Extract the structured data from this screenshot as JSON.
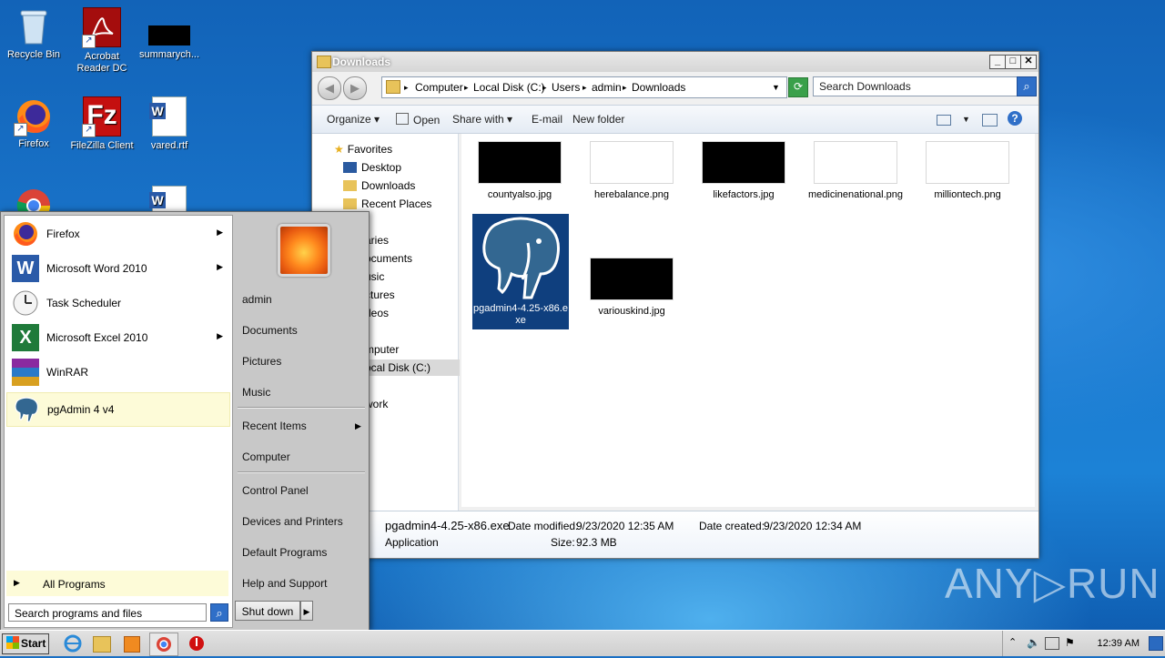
{
  "desktop": {
    "icons": [
      {
        "label": "Recycle Bin"
      },
      {
        "label": "Acrobat Reader DC"
      },
      {
        "label": "summarych..."
      },
      {
        "label": "Firefox"
      },
      {
        "label": "FileZilla Client"
      },
      {
        "label": "vared.rtf"
      }
    ]
  },
  "explorer": {
    "title": "Downloads",
    "breadcrumbs": [
      "Computer",
      "Local Disk (C:)",
      "Users",
      "admin",
      "Downloads"
    ],
    "search_placeholder": "Search Downloads",
    "toolbar": {
      "organize": "Organize",
      "open": "Open",
      "share_with": "Share with",
      "email": "E-mail",
      "new_folder": "New folder"
    },
    "nav": {
      "favorites": "Favorites",
      "desktop": "Desktop",
      "downloads": "Downloads",
      "recent_places": "Recent Places",
      "libraries": "aries",
      "documents": "ocuments",
      "music": "usic",
      "pictures": "ctures",
      "videos": "deos",
      "computer": "mputer",
      "local_disk": "ocal Disk (C:)",
      "network": "work"
    },
    "files": [
      {
        "name": "countyalso.jpg"
      },
      {
        "name": "herebalance.png"
      },
      {
        "name": "likefactors.jpg"
      },
      {
        "name": "medicinenational.png"
      },
      {
        "name": "milliontech.png"
      },
      {
        "name": "pgadmin4-4.25-x86.exe"
      },
      {
        "name": "variouskind.jpg"
      }
    ],
    "details": {
      "filename": "pgadmin4-4.25-x86.exe",
      "date_modified_label": "Date modified:",
      "date_modified": "9/23/2020 12:35 AM",
      "date_created_label": "Date created:",
      "date_created": "9/23/2020 12:34 AM",
      "type": "Application",
      "size_label": "Size:",
      "size": "92.3 MB"
    }
  },
  "startmenu": {
    "programs": [
      {
        "label": "Firefox"
      },
      {
        "label": "Microsoft Word 2010"
      },
      {
        "label": "Task Scheduler"
      },
      {
        "label": "Microsoft Excel 2010"
      },
      {
        "label": "WinRAR"
      },
      {
        "label": "pgAdmin 4 v4"
      }
    ],
    "all_programs": "All Programs",
    "search_placeholder": "Search programs and files",
    "right": {
      "admin": "admin",
      "documents": "Documents",
      "pictures": "Pictures",
      "music": "Music",
      "recent_items": "Recent Items",
      "computer": "Computer",
      "control_panel": "Control Panel",
      "devices_printers": "Devices and Printers",
      "default_programs": "Default Programs",
      "help_support": "Help and Support"
    },
    "shutdown": "Shut down"
  },
  "taskbar": {
    "start": "Start",
    "clock": "12:39 AM"
  },
  "watermark": "ANY▷RUN"
}
